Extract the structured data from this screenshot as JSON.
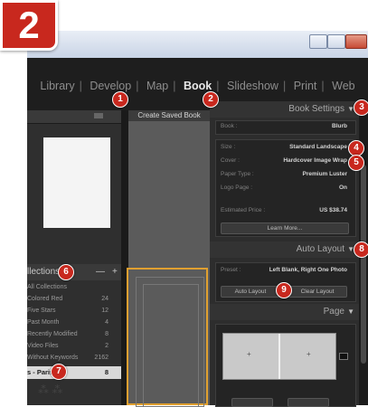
{
  "step_badge": "2",
  "modules": {
    "items": [
      "Library",
      "Develop",
      "Map",
      "Book",
      "Slideshow",
      "Print",
      "Web"
    ],
    "active": "Book"
  },
  "toolbar": {
    "create_saved_book": "Create Saved Book"
  },
  "left_panel": {
    "collections_title": "llections",
    "collections_buttons": [
      "—",
      "+"
    ],
    "collections": [
      {
        "name": "All Collections",
        "count": ""
      },
      {
        "name": "Colored Red",
        "count": "24"
      },
      {
        "name": "Five Stars",
        "count": "12"
      },
      {
        "name": "Past Month",
        "count": "4"
      },
      {
        "name": "Recently Modified",
        "count": "8"
      },
      {
        "name": "Video Files",
        "count": "2"
      },
      {
        "name": "Without Keywords",
        "count": "2162"
      }
    ],
    "selected_collection": {
      "name": "s - Paris",
      "count": "8"
    }
  },
  "book_settings": {
    "title": "Book Settings",
    "book_label": "Book :",
    "book_value": "Blurb",
    "size_label": "Size :",
    "size_value": "Standard Landscape",
    "cover_label": "Cover :",
    "cover_value": "Hardcover Image Wrap",
    "paper_label": "Paper Type :",
    "paper_value": "Premium Luster",
    "logo_label": "Logo Page :",
    "logo_value": "On",
    "price_label": "Estimated Price :",
    "price_value": "US $38.74",
    "learn_more": "Learn More..."
  },
  "auto_layout": {
    "title": "Auto Layout",
    "preset_label": "Preset :",
    "preset_value": "Left Blank, Right One Photo",
    "auto_layout_btn": "Auto Layout",
    "clear_layout_btn": "Clear Layout"
  },
  "page_section": {
    "title": "Page",
    "page_buttons": [
      "+",
      "+"
    ]
  },
  "callouts": [
    "1",
    "2",
    "3",
    "4",
    "5",
    "6",
    "7",
    "8",
    "9"
  ],
  "colors": {
    "callout_red": "#c8281e",
    "panel_bg": "#2d2d2d",
    "accent_orange": "#e0a030"
  }
}
